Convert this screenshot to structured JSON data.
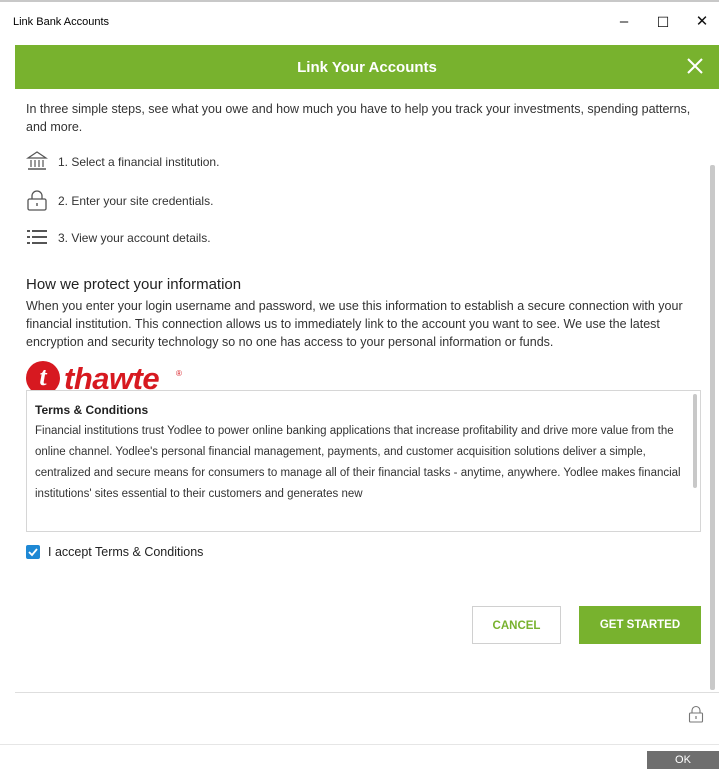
{
  "window": {
    "title": "Link Bank Accounts",
    "minimize": "–",
    "maximize": "☐",
    "close": "✕"
  },
  "header": {
    "title": "Link Your Accounts",
    "accent": "#78b22e"
  },
  "intro": "In three simple steps, see what you owe and how much you have to help you track your investments, spending patterns, and more.",
  "steps": [
    {
      "label": "1. Select a financial institution.",
      "icon": "bank-icon"
    },
    {
      "label": "2. Enter your site credentials.",
      "icon": "lock-icon"
    },
    {
      "label": "3. View your account details.",
      "icon": "list-icon"
    }
  ],
  "protect": {
    "title": "How we protect your information",
    "body": "When you enter your login username and password, we use this information to establish a secure connection with your financial institution. This connection allows us to immediately link to the account you want to see. We use the latest encryption and security technology so no one has access to your personal information or funds."
  },
  "logo": {
    "text": "thawte",
    "mark": "t",
    "reg": "®",
    "color": "#d71920"
  },
  "terms": {
    "title": "Terms & Conditions",
    "body": "Financial institutions trust Yodlee to power online banking applications that increase profitability and drive more value from the online channel. Yodlee's personal financial management, payments, and customer acquisition solutions deliver a simple, centralized and secure means for consumers to manage all of their financial tasks - anytime, anywhere. Yodlee makes financial institutions' sites essential to their customers and generates new"
  },
  "accept": {
    "label": "I accept Terms & Conditions",
    "checked": true
  },
  "buttons": {
    "cancel": "CANCEL",
    "start": "GET STARTED"
  },
  "footer": {
    "ok": "OK"
  }
}
